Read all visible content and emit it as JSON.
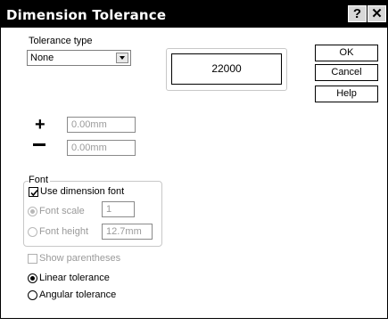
{
  "window": {
    "title": "Dimension Tolerance",
    "help_glyph": "?",
    "close_glyph": "✕"
  },
  "tolerance": {
    "label": "Tolerance type",
    "selected": "None"
  },
  "preview": {
    "value": "22000"
  },
  "buttons": {
    "ok": "OK",
    "cancel": "Cancel",
    "help": "Help"
  },
  "values": {
    "plus_symbol": "+",
    "upper": "0.00mm",
    "lower": "0.00mm"
  },
  "font": {
    "group_label": "Font",
    "use_dimension_font": {
      "label": "Use dimension font",
      "checked": true
    },
    "font_scale": {
      "label": "Font scale",
      "value": "1",
      "selected": true,
      "enabled": false
    },
    "font_height": {
      "label": "Font height",
      "value": "12.7mm",
      "selected": false,
      "enabled": false
    }
  },
  "show_parentheses": {
    "label": "Show parentheses",
    "checked": false,
    "enabled": false
  },
  "mode": {
    "linear": {
      "label": "Linear tolerance",
      "selected": true
    },
    "angular": {
      "label": "Angular tolerance",
      "selected": false
    }
  }
}
